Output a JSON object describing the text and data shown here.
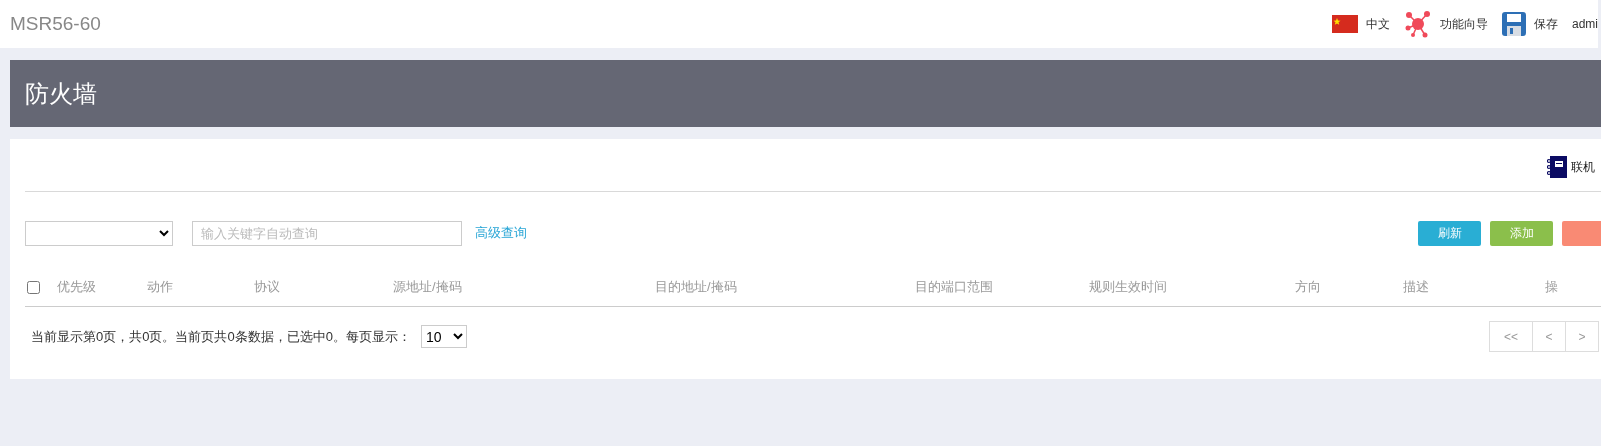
{
  "topbar": {
    "title": "MSR56-60",
    "items": [
      {
        "kind": "flag",
        "label": "中文"
      },
      {
        "kind": "wizard",
        "label": "功能向导"
      },
      {
        "kind": "save",
        "label": "保存"
      },
      {
        "kind": "user",
        "label": "admi"
      }
    ]
  },
  "header": {
    "title": "防火墙"
  },
  "toolbar": {
    "link": "联机"
  },
  "filter": {
    "search_placeholder": "输入关键字自动查询",
    "advanced": "高级查询"
  },
  "buttons": [
    {
      "kind": "refresh",
      "label": "刷新"
    },
    {
      "kind": "add",
      "label": "添加"
    },
    {
      "kind": "danger"
    }
  ],
  "table": {
    "select_all": {
      "checked": false
    },
    "columns": [
      "优先级",
      "动作",
      "协议",
      "源地址/掩码",
      "目的地址/掩码",
      "目的端口范围",
      "规则生效时间",
      "方向",
      "描述",
      "操"
    ]
  },
  "footer": {
    "summary": "当前显示第0页，共0页。当前页共0条数据，已选中0。每页显示：",
    "page_size": "10",
    "pager": [
      "<<",
      "<",
      ">"
    ]
  }
}
